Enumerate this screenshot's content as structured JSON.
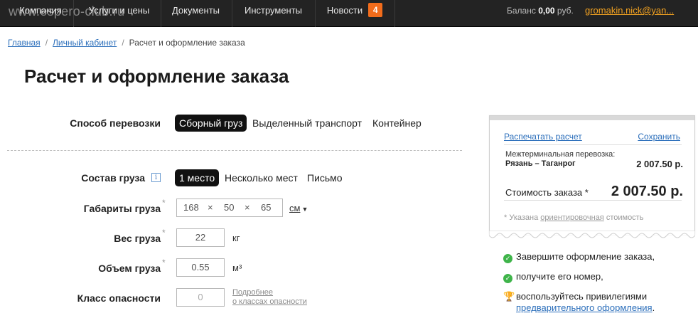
{
  "watermark": "www.espero-club.ru",
  "nav": {
    "items": [
      "Компания",
      "Услуги и цены",
      "Документы",
      "Инструменты",
      "Новости"
    ],
    "news_count": "4",
    "balance_label": "Баланс",
    "balance_value": "0,00",
    "balance_currency": "руб.",
    "user": "gromakin.nick@yan..."
  },
  "breadcrumb": {
    "home": "Главная",
    "cabinet": "Личный кабинет",
    "current": "Расчет и оформление заказа"
  },
  "title": "Расчет и оформление заказа",
  "form": {
    "transport": {
      "label": "Способ перевозки",
      "options": [
        "Сборный груз",
        "Выделенный транспорт",
        "Контейнер"
      ],
      "selected": 0
    },
    "composition": {
      "label": "Состав груза",
      "info": "i",
      "options": [
        "1 место",
        "Несколько мест",
        "Письмо"
      ],
      "selected": 0
    },
    "dimensions": {
      "label": "Габариты груза",
      "length": "168",
      "width": "50",
      "height": "65",
      "times": "×",
      "unit": "см"
    },
    "weight": {
      "label": "Вес груза",
      "value": "22",
      "unit": "кг"
    },
    "volume": {
      "label": "Объем груза",
      "value": "0.55",
      "unit": "м³"
    },
    "hazard": {
      "label": "Класс опасности",
      "value": "0",
      "link_line1": "Подробнее",
      "link_line2": "о классах опасности"
    },
    "asterisk": "*"
  },
  "summary": {
    "print": "Распечатать расчет",
    "save": "Сохранить",
    "route_label": "Межтерминальная перевозка:",
    "route": "Рязань – Таганрог",
    "route_price": "2 007.50 р.",
    "total_label": "Стоимость заказа *",
    "total": "2 007.50 р.",
    "note_prefix": "* Указана",
    "note_link": "ориентировочная",
    "note_suffix": "стоимость"
  },
  "steps": {
    "step1": "Завершите оформление заказа,",
    "step2": "получите его номер,",
    "step3": "воспользуйтесь привилегиями",
    "step3_link": "предварительного оформления",
    "step3_end": "."
  }
}
